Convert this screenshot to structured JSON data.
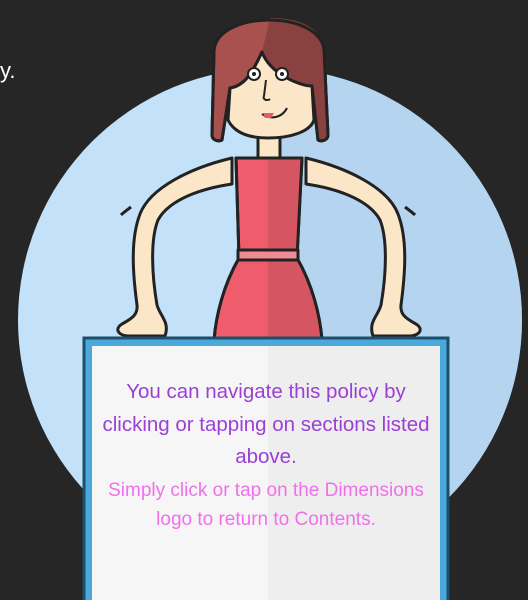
{
  "page": {
    "stray_char": "y.",
    "message_primary": "You can navigate this policy by clicking or tapping on sections listed above.",
    "message_secondary": "Simply click or tap on the Dimensions logo to return to Contents."
  },
  "colors": {
    "background": "#262626",
    "circle": "#c3e1f8",
    "circle_shade": "#a8cbe8",
    "hair": "#a8514f",
    "skin": "#fbe6c8",
    "dress": "#ef5d6c",
    "card_frame": "#4aa8db",
    "card_face": "#f6f6f6",
    "text_primary": "#9b40d6",
    "text_secondary": "#f070ec"
  }
}
